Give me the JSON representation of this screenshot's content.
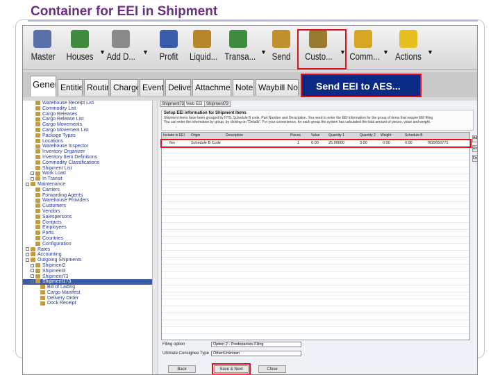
{
  "slide": {
    "title": "Container for EEI in Shipment"
  },
  "ribbon": {
    "buttons": [
      {
        "label": "Master",
        "icon": "person-icon",
        "color": "#5a6fa8"
      },
      {
        "label": "Houses",
        "icon": "houses-icon",
        "color": "#3f8c3f"
      },
      {
        "label": "Add D...",
        "icon": "add-document-icon",
        "color": "#8a8a8a"
      },
      {
        "label": "Profit",
        "icon": "profit-icon",
        "color": "#3a5ca8"
      },
      {
        "label": "Liquid...",
        "icon": "liquidate-icon",
        "color": "#b8862a"
      },
      {
        "label": "Transa...",
        "icon": "transaction-icon",
        "color": "#3f8c3f"
      },
      {
        "label": "Send",
        "icon": "send-envelope-icon",
        "color": "#c1902e"
      },
      {
        "label": "Custo...",
        "icon": "customs-scale-icon",
        "color": "#9a7a30"
      },
      {
        "label": "Comm...",
        "icon": "commodity-coins-icon",
        "color": "#d6a622"
      },
      {
        "label": "Actions",
        "icon": "star-icon",
        "color": "#e6c020"
      }
    ]
  },
  "tabs": [
    "General",
    "Entities",
    "Routing",
    "Charges",
    "Events",
    "Delivery",
    "Attachments",
    "Notes",
    "Waybill Notes"
  ],
  "popup": {
    "send_eei": "Send EEI to AES..."
  },
  "tree": {
    "items": [
      "Warehouse Receipt List",
      "Commodity List",
      "Cargo Releases",
      "Cargo Release List",
      "Cargo Movements",
      "Cargo Movement List",
      "Package Types",
      "Locations",
      "Warehouse Inspector",
      "Inventory Organizer",
      "Inventory Item Definitions",
      "Commodity Classifications",
      "Shipment List",
      "Work Load",
      "In Transit",
      "Maintenance",
      "Carriers",
      "Forwarding Agents",
      "Warehouse Providers",
      "Customers",
      "Vendors",
      "Salespersons",
      "Contacts",
      "Employees",
      "Ports",
      "Countries",
      "Configuration",
      "Rates",
      "Accounting",
      "Outgoing Shipments",
      "Shipment2",
      "Shipment3",
      "Shipment73",
      "Shipment173",
      "Bill of Lading",
      "Cargo Manifest",
      "Delivery Order",
      "Dock Receipt"
    ]
  },
  "inner_tabs": [
    "Shipment73",
    "Web EEI",
    "Shipment73"
  ],
  "setup": {
    "heading": "Setup EEI information for Shipment Items",
    "desc1": "Shipment items have been grouped by HTS, Schedule B code, Part Number and Description. You need to enter the EEI information for the group of items that require EEI filing",
    "desc2": "You can enter the information by group, by clicking on \"Details\". For your convenience, for each group the system has calculated the total amount of pieces, value and weight."
  },
  "grid": {
    "headers": [
      "Include in EEI",
      "Origin",
      "Description",
      "Pieces",
      "Value",
      "Quantity 1",
      "Quantity 2",
      "Weight",
      "Schedule B"
    ],
    "row": [
      "Yes",
      "Schedule B Code",
      "",
      "1",
      "0.00",
      "25.00000",
      "3.00",
      "0.00",
      "0.00",
      "7825050771"
    ]
  },
  "side_buttons": [
    "Add...",
    "Reset EEI",
    "Details"
  ],
  "form": {
    "filing_label": "Filing option",
    "filing_value": "Option 2 - Predeparture Filing",
    "consignee_label": "Ultimate Consignee Type",
    "consignee_value": "Other/Unknown"
  },
  "footer": {
    "back": "Back",
    "save_next": "Save & Next",
    "close": "Close"
  }
}
